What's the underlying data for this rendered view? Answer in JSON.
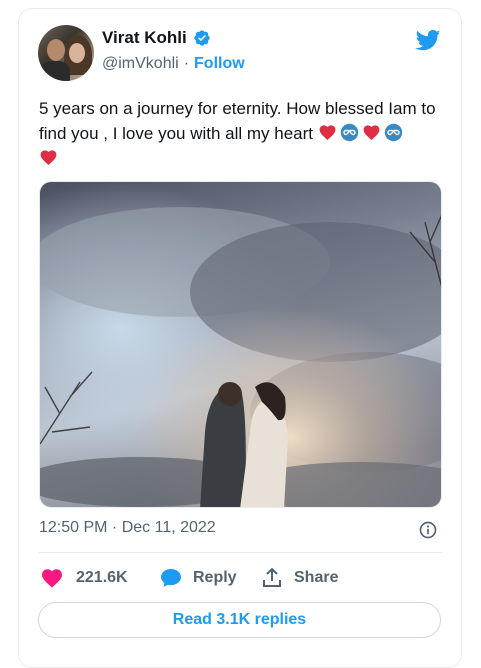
{
  "author": {
    "name": "Virat Kohli",
    "handle": "@imVkohli",
    "separator": "·",
    "follow_label": "Follow"
  },
  "tweet": {
    "text": "5 years on a journey for eternity. How blessed Iam to find you , I love you with all my heart",
    "emojis": [
      "red-heart",
      "infinity",
      "red-heart",
      "infinity",
      "red-heart"
    ],
    "timestamp": "12:50 PM · Dec 11, 2022"
  },
  "actions": {
    "likes_count": "221.6K",
    "reply_label": "Reply",
    "share_label": "Share",
    "read_replies_label": "Read 3.1K replies"
  },
  "colors": {
    "accent": "#1d9bf0",
    "like": "#f91880",
    "text": "#0f1419",
    "muted": "#536471"
  },
  "icons": [
    "verified-badge-icon",
    "twitter-bird-icon",
    "info-icon",
    "heart-icon",
    "reply-bubble-icon",
    "share-icon"
  ]
}
